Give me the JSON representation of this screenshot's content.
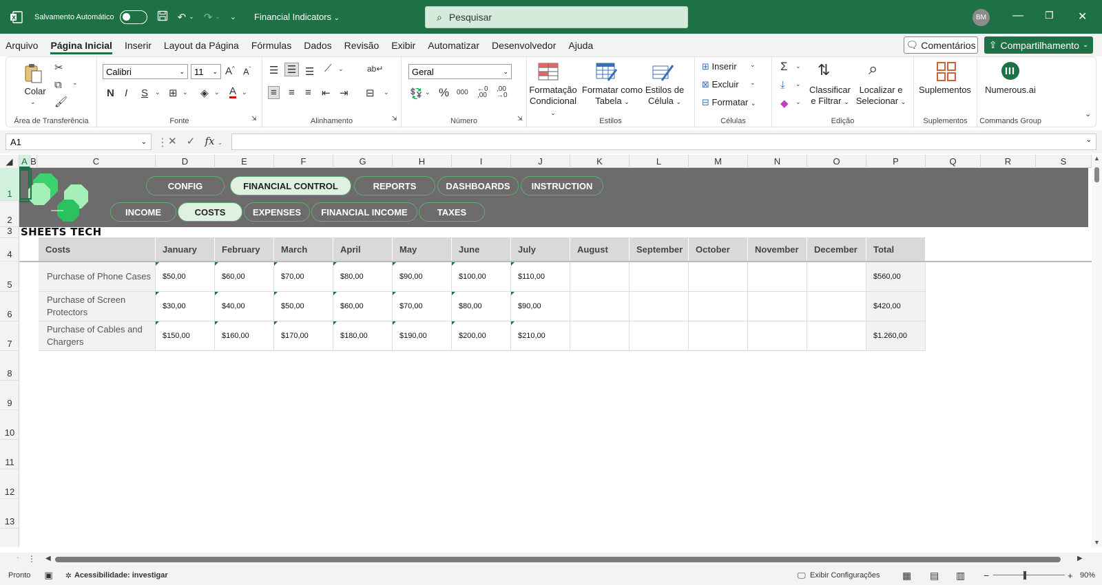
{
  "titlebar": {
    "autosave_label": "Salvamento Automático",
    "doc_name": "Financial Indicators",
    "search_placeholder": "Pesquisar",
    "avatar": "BM"
  },
  "menu": {
    "items": [
      "Arquivo",
      "Página Inicial",
      "Inserir",
      "Layout da Página",
      "Fórmulas",
      "Dados",
      "Revisão",
      "Exibir",
      "Automatizar",
      "Desenvolvedor",
      "Ajuda"
    ],
    "comments": "Comentários",
    "share": "Compartilhamento"
  },
  "ribbon": {
    "paste": "Colar",
    "clipboard_label": "Área de Transferência",
    "font_name": "Calibri",
    "font_size": "11",
    "font_label": "Fonte",
    "align_label": "Alinhamento",
    "number_format": "Geral",
    "number_label": "Número",
    "cond_format_1": "Formatação",
    "cond_format_2": "Condicional",
    "format_table_1": "Formatar como",
    "format_table_2": "Tabela",
    "cell_styles_1": "Estilos de",
    "cell_styles_2": "Célula",
    "styles_label": "Estilos",
    "insert": "Inserir",
    "delete": "Excluir",
    "format": "Formatar",
    "cells_label": "Células",
    "sort_1": "Classificar",
    "sort_2": "e Filtrar",
    "find_1": "Localizar e",
    "find_2": "Selecionar",
    "edit_label": "Edição",
    "addins": "Suplementos",
    "addins_label": "Suplementos",
    "numerous": "Numerous.ai",
    "commands_label": "Commands Group"
  },
  "formula": {
    "name_box": "A1"
  },
  "columns": [
    "A",
    "B",
    "C",
    "D",
    "E",
    "F",
    "G",
    "H",
    "I",
    "J",
    "K",
    "L",
    "M",
    "N",
    "O",
    "P",
    "Q",
    "R",
    "S"
  ],
  "rows": [
    "1",
    "2",
    "3",
    "4",
    "5",
    "6",
    "7",
    "8",
    "9",
    "10",
    "11",
    "12",
    "13"
  ],
  "nav": {
    "top": [
      "CONFIG",
      "FINANCIAL CONTROL",
      "REPORTS",
      "DASHBOARDS",
      "INSTRUCTION"
    ],
    "bottom": [
      "INCOME",
      "COSTS",
      "EXPENSES",
      "FINANCIAL INCOME",
      "TAXES"
    ]
  },
  "brand": "SHEETS TECH",
  "table": {
    "headers": [
      "Costs",
      "January",
      "February",
      "March",
      "April",
      "May",
      "June",
      "July",
      "August",
      "September",
      "October",
      "November",
      "December",
      "Total"
    ],
    "rows": [
      {
        "label": "Purchase of Phone Cases",
        "values": [
          "$50,00",
          "$60,00",
          "$70,00",
          "$80,00",
          "$90,00",
          "$100,00",
          "$110,00",
          "",
          "",
          "",
          "",
          ""
        ],
        "total": "$560,00"
      },
      {
        "label": "Purchase of Screen Protectors",
        "values": [
          "$30,00",
          "$40,00",
          "$50,00",
          "$60,00",
          "$70,00",
          "$80,00",
          "$90,00",
          "",
          "",
          "",
          "",
          ""
        ],
        "total": "$420,00"
      },
      {
        "label": "Purchase of Cables and Chargers",
        "values": [
          "$150,00",
          "$160,00",
          "$170,00",
          "$180,00",
          "$190,00",
          "$200,00",
          "$210,00",
          "",
          "",
          "",
          "",
          ""
        ],
        "total": "$1.260,00"
      }
    ]
  },
  "status": {
    "ready": "Pronto",
    "accessibility": "Acessibilidade: investigar",
    "display_settings": "Exibir Configurações",
    "zoom": "90%"
  },
  "colors": {
    "excel_green": "#1e7145",
    "banner": "#6d6b6c",
    "pill_border": "#5fae72"
  }
}
